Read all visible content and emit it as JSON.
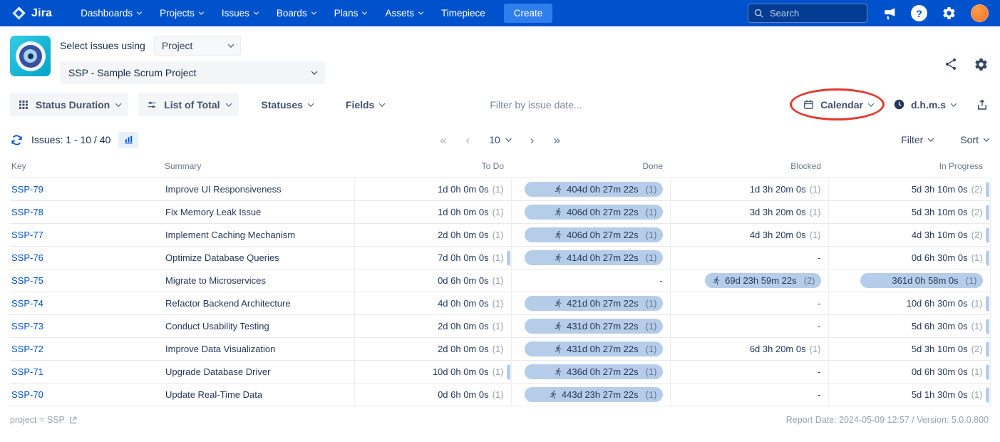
{
  "colors": {
    "nav_blue": "#0052CC",
    "create_blue": "#2E7EED",
    "link_blue": "#0052CC",
    "pill_blue": "#B5CDE9",
    "annotation_red": "#E5382C",
    "avatar_orange": "#ED702D",
    "muted_gray": "#97A0AF"
  },
  "icons": {
    "first_page": "«",
    "prev_page": "‹",
    "next_page": "›",
    "last_page": "»",
    "help": "?"
  },
  "nav": {
    "brand": "Jira",
    "items": [
      {
        "label": "Dashboards"
      },
      {
        "label": "Projects"
      },
      {
        "label": "Issues"
      },
      {
        "label": "Boards"
      },
      {
        "label": "Plans"
      },
      {
        "label": "Assets"
      },
      {
        "label": "Timepiece"
      }
    ],
    "create_label": "Create",
    "search_placeholder": "Search"
  },
  "header": {
    "select_issues_label": "Select issues using",
    "mode_value": "Project",
    "project_value": "SSP - Sample Scrum Project"
  },
  "toolbar": {
    "report_type": "Status Duration",
    "view_mode": "List of Total",
    "statuses": "Statuses",
    "fields": "Fields",
    "date_filter_placeholder": "Filter by issue date...",
    "calendar": "Calendar",
    "time_format": "d.h.m.s"
  },
  "pagination": {
    "issues_label": "Issues: 1 - 10 / 40",
    "page_size": "10",
    "filter_label": "Filter",
    "sort_label": "Sort"
  },
  "table": {
    "columns": [
      "Key",
      "Summary",
      "To Do",
      "Done",
      "Blocked",
      "In Progress"
    ],
    "rows": [
      {
        "key": "SSP-79",
        "summary": "Improve UI Responsiveness",
        "todo": {
          "v": "1d 0h 0m 0s",
          "c": "(1)"
        },
        "done": {
          "v": "404d 0h 27m 22s",
          "c": "(1)",
          "pill": true,
          "runner": true
        },
        "blocked": {
          "v": "1d 3h 20m 0s",
          "c": "(1)"
        },
        "inprogress": {
          "v": "5d 3h 10m 0s",
          "c": "(2)",
          "sliver": true
        }
      },
      {
        "key": "SSP-78",
        "summary": "Fix Memory Leak Issue",
        "todo": {
          "v": "1d 0h 0m 0s",
          "c": "(1)"
        },
        "done": {
          "v": "406d 0h 27m 22s",
          "c": "(1)",
          "pill": true,
          "runner": true
        },
        "blocked": {
          "v": "3d 3h 20m 0s",
          "c": "(1)"
        },
        "inprogress": {
          "v": "5d 3h 10m 0s",
          "c": "(2)",
          "sliver": true
        }
      },
      {
        "key": "SSP-77",
        "summary": "Implement Caching Mechanism",
        "todo": {
          "v": "2d 0h 0m 0s",
          "c": "(1)"
        },
        "done": {
          "v": "406d 0h 27m 22s",
          "c": "(1)",
          "pill": true,
          "runner": true
        },
        "blocked": {
          "v": "4d 3h 20m 0s",
          "c": "(1)"
        },
        "inprogress": {
          "v": "4d 3h 10m 0s",
          "c": "(2)",
          "sliver": true
        }
      },
      {
        "key": "SSP-76",
        "summary": "Optimize Database Queries",
        "todo": {
          "v": "7d 0h 0m 0s",
          "c": "(1)",
          "sliver": true
        },
        "done": {
          "v": "414d 0h 27m 22s",
          "c": "(1)",
          "pill": true,
          "runner": true
        },
        "blocked": {
          "v": "-"
        },
        "inprogress": {
          "v": "0d 6h 30m 0s",
          "c": "(1)",
          "sliver": true
        }
      },
      {
        "key": "SSP-75",
        "summary": "Migrate to Microservices",
        "todo": {
          "v": "0d 6h 0m 0s",
          "c": "(1)"
        },
        "done": {
          "v": "-"
        },
        "blocked": {
          "v": "69d 23h 59m 22s",
          "c": "(2)",
          "pill": true,
          "runner": true
        },
        "inprogress": {
          "v": "361d 0h 58m 0s",
          "c": "(1)",
          "pill": true
        }
      },
      {
        "key": "SSP-74",
        "summary": "Refactor Backend Architecture",
        "todo": {
          "v": "4d 0h 0m 0s",
          "c": "(1)"
        },
        "done": {
          "v": "421d 0h 27m 22s",
          "c": "(1)",
          "pill": true,
          "runner": true
        },
        "blocked": {
          "v": "-"
        },
        "inprogress": {
          "v": "10d 6h 30m 0s",
          "c": "(1)",
          "sliver": true
        }
      },
      {
        "key": "SSP-73",
        "summary": "Conduct Usability Testing",
        "todo": {
          "v": "2d 0h 0m 0s",
          "c": "(1)"
        },
        "done": {
          "v": "431d 0h 27m 22s",
          "c": "(1)",
          "pill": true,
          "runner": true
        },
        "blocked": {
          "v": "-"
        },
        "inprogress": {
          "v": "5d 6h 30m 0s",
          "c": "(1)",
          "sliver": true
        }
      },
      {
        "key": "SSP-72",
        "summary": "Improve Data Visualization",
        "todo": {
          "v": "2d 0h 0m 0s",
          "c": "(1)"
        },
        "done": {
          "v": "431d 0h 27m 22s",
          "c": "(1)",
          "pill": true,
          "runner": true
        },
        "blocked": {
          "v": "6d 3h 20m 0s",
          "c": "(1)"
        },
        "inprogress": {
          "v": "5d 3h 10m 0s",
          "c": "(2)",
          "sliver": true
        }
      },
      {
        "key": "SSP-71",
        "summary": "Upgrade Database Driver",
        "todo": {
          "v": "10d 0h 0m 0s",
          "c": "(1)",
          "sliver": true
        },
        "done": {
          "v": "436d 0h 27m 22s",
          "c": "(1)",
          "pill": true,
          "runner": true
        },
        "blocked": {
          "v": "-"
        },
        "inprogress": {
          "v": "0d 6h 30m 0s",
          "c": "(1)",
          "sliver": true
        }
      },
      {
        "key": "SSP-70",
        "summary": "Update Real-Time Data",
        "todo": {
          "v": "0d 6h 0m 0s",
          "c": "(1)"
        },
        "done": {
          "v": "443d 23h 27m 22s",
          "c": "(1)",
          "pill": true,
          "runner": true
        },
        "blocked": {
          "v": "-"
        },
        "inprogress": {
          "v": "5d 1h 30m 0s",
          "c": "(1)",
          "sliver": true
        }
      }
    ]
  },
  "footer": {
    "query": "project = SSP",
    "report_info": "Report Date: 2024-05-09 12:57 / Version: 5.0.0.800"
  }
}
